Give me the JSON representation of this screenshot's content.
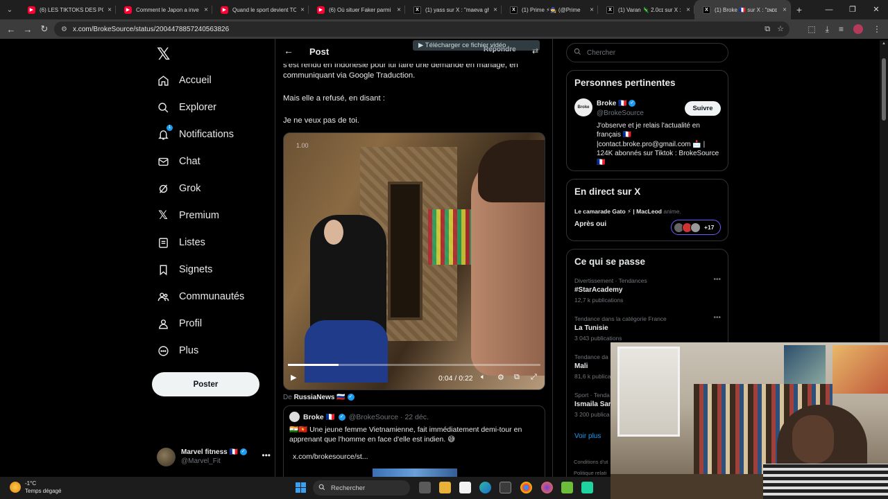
{
  "browser": {
    "tabs": [
      {
        "title": "(6) LES TIKTOKS DES POLI",
        "favicon": "youtube-icon"
      },
      {
        "title": "Comment le Japon a inve",
        "favicon": "youtube-icon"
      },
      {
        "title": "Quand le sport devient TC",
        "favicon": "youtube-icon"
      },
      {
        "title": "(6) Où situer Faker parmi",
        "favicon": "youtube-icon"
      },
      {
        "title": "(1) yass sur X : \"maeva gh",
        "favicon": "x-icon"
      },
      {
        "title": "(1) Prime ⚡🧙 (@Prime",
        "favicon": "x-icon"
      },
      {
        "title": "(1) Varan 🦎 2.0cɪ sur X :",
        "favicon": "x-icon"
      },
      {
        "title": "(1) Broke 🇫🇷 sur X : \"ɪɴᴅɪ",
        "favicon": "x-icon",
        "active": true
      }
    ],
    "url": "x.com/BrokeSource/status/2004478857240563826"
  },
  "nav": {
    "items": [
      {
        "label": "Accueil",
        "icon": "home-icon"
      },
      {
        "label": "Explorer",
        "icon": "search-icon"
      },
      {
        "label": "Notifications",
        "icon": "bell-icon",
        "badge": "1"
      },
      {
        "label": "Chat",
        "icon": "mail-icon"
      },
      {
        "label": "Grok",
        "icon": "grok-icon"
      },
      {
        "label": "Premium",
        "icon": "x-icon"
      },
      {
        "label": "Listes",
        "icon": "list-icon"
      },
      {
        "label": "Signets",
        "icon": "bookmark-icon"
      },
      {
        "label": "Communautés",
        "icon": "people-icon"
      },
      {
        "label": "Profil",
        "icon": "person-icon"
      },
      {
        "label": "Plus",
        "icon": "more-circle-icon"
      }
    ],
    "post_button": "Poster",
    "account": {
      "name": "Marvel fitness 🇫🇷",
      "handle": "@Marvel_Fit"
    }
  },
  "post": {
    "header_title": "Post",
    "reply_label": "Répondre",
    "download_overlay": "▶ Télécharger ce fichier vidéo",
    "text_lines": [
      "s'est rendu en Indonésie pour lui faire une demande en mariage, en communiquant via Google Traduction.",
      "Mais elle a refusé, en disant :",
      "Je ne veux pas de toi."
    ],
    "video": {
      "speed_label": "1.00",
      "time": "0:04 / 0:22",
      "progress": 0.2
    },
    "from_prefix": "De",
    "from_name": "RussiaNews 🇷🇺",
    "quote": {
      "name": "Broke 🇫🇷",
      "handle": "@BrokeSource · 22 déc.",
      "text": "🇮🇳🇻🇳 Une jeune femme Vietnamienne, fait immédiatement demi-tour en apprenant que l'homme en face d'elle est indien. 😅",
      "link": "x.com/brokesource/st..."
    }
  },
  "sidebar": {
    "search_placeholder": "Chercher",
    "relevant": {
      "title": "Personnes pertinentes",
      "name": "Broke 🇫🇷",
      "handle": "@BrokeSource",
      "follow_label": "Suivre",
      "bio": "J'observe et je relais l'actualité en français 🇫🇷 |contact.broke.pro@gmail.com 📩 | 124K abonnés sur Tiktok : BrokeSource 🇫🇷"
    },
    "live": {
      "title": "En direct sur X",
      "host": "Le camarade Gato ⚡ | MacLeod",
      "host_suffix": "anime.",
      "stream_title": "Après oui",
      "listener_count": "+17"
    },
    "trends": {
      "title": "Ce qui se passe",
      "items": [
        {
          "category": "Divertissement · Tendances",
          "topic": "#StarAcademy",
          "count": "12,7 k publications"
        },
        {
          "category": "Tendance dans la catégorie France",
          "topic": "La Tunisie",
          "count": "3 043 publications"
        },
        {
          "category": "Tendance da",
          "topic": "Mali",
          "count": "81,6 k publicati"
        },
        {
          "category": "Sport · Tenda",
          "topic": "Ismaila Sar",
          "count": "3 200 publica"
        }
      ],
      "show_more": "Voir plus"
    },
    "footer": [
      "Conditions d'ut",
      "Politique relati"
    ]
  },
  "taskbar": {
    "temperature": "-1°C",
    "weather": "Temps dégagé",
    "search_label": "Rechercher"
  },
  "colors": {
    "accent": "#1d9bf0",
    "background": "#000000",
    "border": "#2f3336",
    "muted": "#71767b"
  }
}
